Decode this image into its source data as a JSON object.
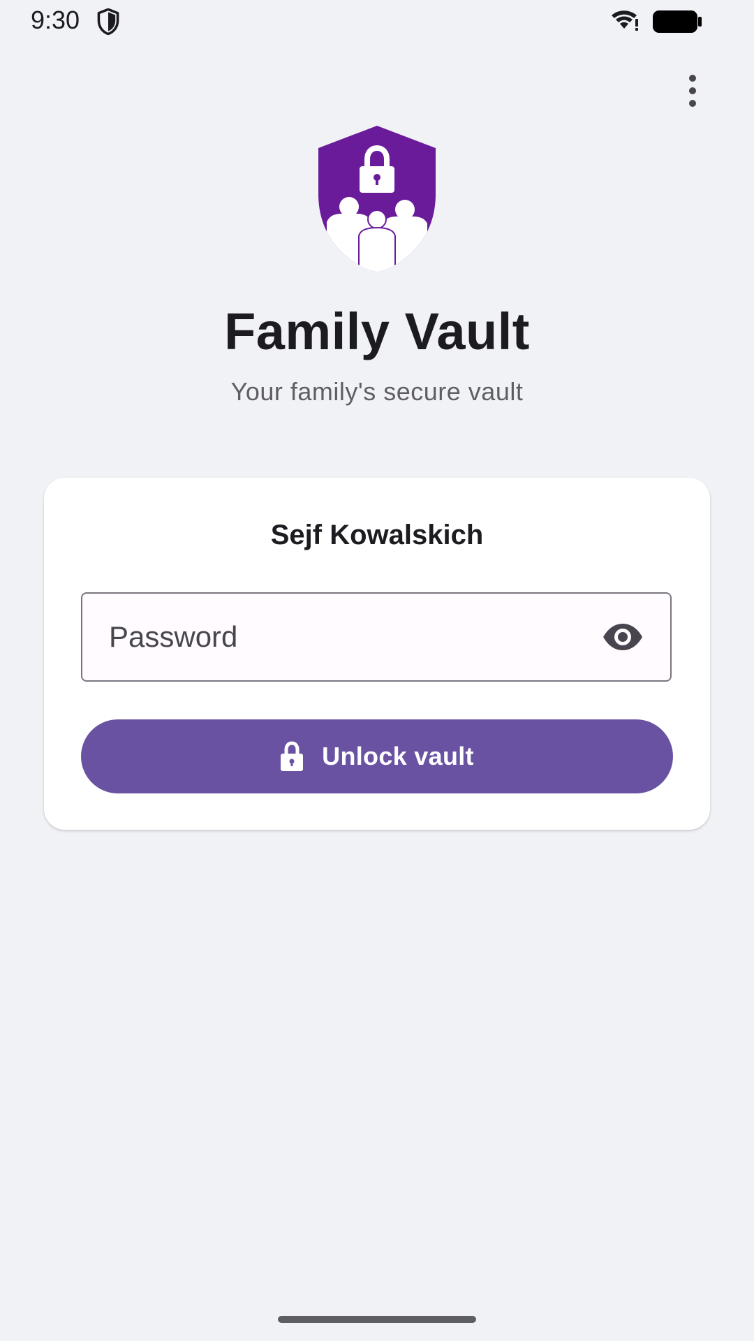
{
  "status_bar": {
    "time": "9:30",
    "icons": [
      "shield-icon",
      "wifi-icon",
      "battery-icon"
    ]
  },
  "toolbar": {
    "menu_icon": "more-vertical-icon"
  },
  "branding": {
    "logo_icon": "family-shield-lock-icon",
    "title": "Family Vault",
    "subtitle": "Your family's secure vault"
  },
  "unlock_card": {
    "vault_name": "Sejf Kowalskich",
    "password": {
      "value": "",
      "placeholder": "Password",
      "visibility_icon": "eye-icon"
    },
    "unlock_button": {
      "label": "Unlock vault",
      "icon": "lock-icon"
    }
  },
  "colors": {
    "background": "#f1f2f6",
    "card": "#ffffff",
    "primary": "#6a52a3",
    "logo": "#6a1b9a",
    "title_text": "#1c1b1f",
    "subtitle_text": "#5f5e66",
    "field_border": "#7a7680"
  }
}
